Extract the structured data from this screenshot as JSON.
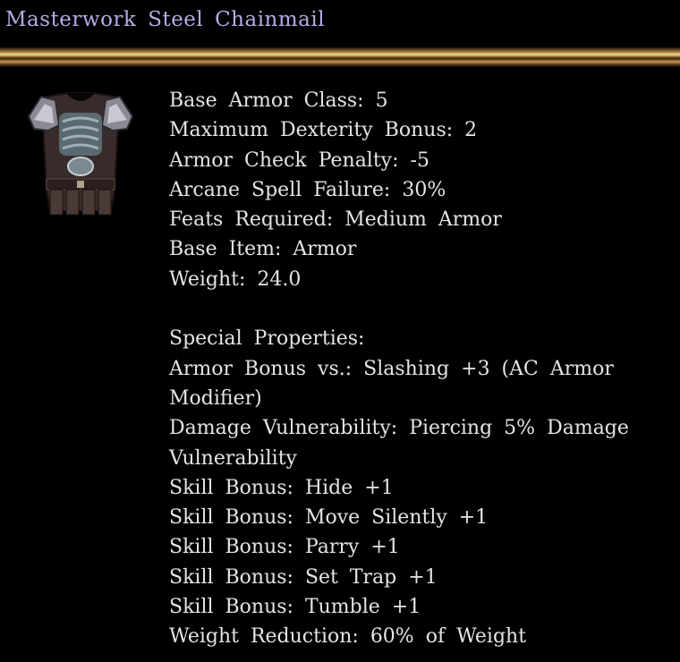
{
  "item": {
    "name": "Masterwork Steel Chainmail",
    "icon": "chainmail-armor-icon"
  },
  "stats": [
    "Base Armor Class: 5",
    "Maximum Dexterity Bonus: 2",
    "Armor Check Penalty: -5",
    "Arcane Spell Failure: 30%",
    "Feats Required: Medium Armor",
    "Base Item: Armor",
    "Weight: 24.0"
  ],
  "special": {
    "heading": "Special Properties:",
    "lines": [
      "Armor Bonus vs.: Slashing +3 (AC Armor",
      "Modifier)",
      "Damage Vulnerability: Piercing 5% Damage",
      "Vulnerability",
      "Skill Bonus: Hide +1",
      "Skill Bonus: Move Silently +1",
      "Skill Bonus: Parry +1",
      "Skill Bonus: Set Trap +1",
      "Skill Bonus: Tumble +1",
      "Weight Reduction: 60% of Weight"
    ]
  },
  "colors": {
    "title": "#b9a9e6",
    "text": "#e4e4e4",
    "background": "#000000",
    "divider": "#c89a55"
  }
}
